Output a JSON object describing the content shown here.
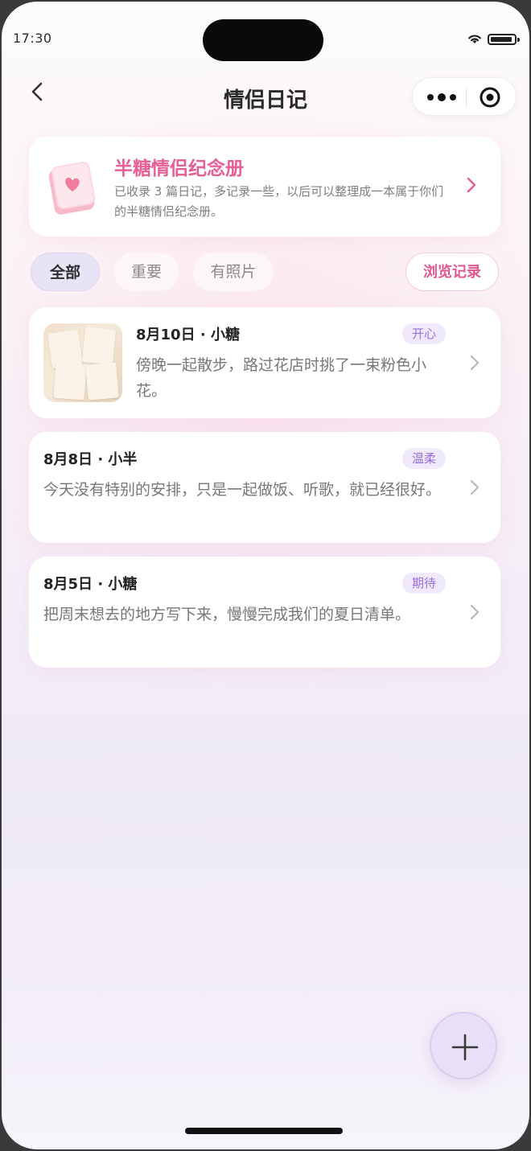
{
  "status_bar": {
    "time": "17:30"
  },
  "nav": {
    "title": "情侣日记"
  },
  "album": {
    "title": "半糖情侣纪念册",
    "description": "已收录 3 篇日记，多记录一些，以后可以整理成一本属于你们的半糖情侣纪念册。"
  },
  "filters": {
    "all": "全部",
    "important": "重要",
    "with_photo": "有照片",
    "browse_history": "浏览记录"
  },
  "entries": [
    {
      "meta": "8月10日 · 小糖",
      "mood": "开心",
      "text": "傍晚一起散步，路过花店时挑了一束粉色小花。",
      "has_photo": true
    },
    {
      "meta": "8月8日 · 小半",
      "mood": "温柔",
      "text": "今天没有特别的安排，只是一起做饭、听歌，就已经很好。",
      "has_photo": false
    },
    {
      "meta": "8月5日 · 小糖",
      "mood": "期待",
      "text": "把周末想去的地方写下来，慢慢完成我们的夏日清单。",
      "has_photo": false
    }
  ],
  "colors": {
    "accent_pink": "#e85f95",
    "tag_purple": "#9a6ce0",
    "chip_active_bg": "#e9e3f6"
  },
  "icons": {
    "back": "back-icon",
    "more": "more-icon",
    "miniapp_close": "target-icon",
    "album": "book-icon",
    "chevron": "chevron-right-icon",
    "add": "plus-icon"
  }
}
